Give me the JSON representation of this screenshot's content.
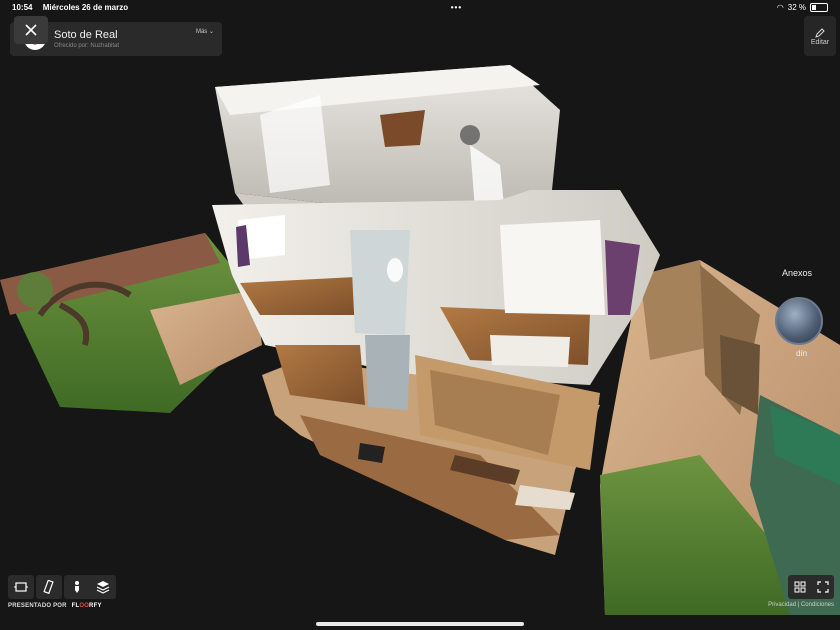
{
  "status": {
    "time": "10:54",
    "date": "Miércoles 26 de marzo",
    "dots": "•••",
    "battery": "32 %",
    "battery_level": 0.32
  },
  "header": {
    "title": "Soto de Real",
    "subtitle": "Ofrecido por: Nuzhabitat",
    "menu_label": "Más",
    "edit_label": "Editar"
  },
  "hotspots": {
    "anexos": "Anexos",
    "jardin": "dín"
  },
  "footer": {
    "presentado": "PRESENTADO POR",
    "brand_a": "FL",
    "brand_b": "OO",
    "brand_c": "RFY",
    "links": "Privacidad | Condiciones"
  },
  "colors": {
    "background": "#161616",
    "grass": "#4e7a2c",
    "wood": "#a0693a",
    "wall": "#e4e2dc",
    "brick": "#8a5a45"
  },
  "icons": [
    "close-icon",
    "chevron-down-icon",
    "pencil-icon",
    "floorplan-icon",
    "ruler-icon",
    "person-icon",
    "layers-icon",
    "grid-icon",
    "fullscreen-icon"
  ]
}
